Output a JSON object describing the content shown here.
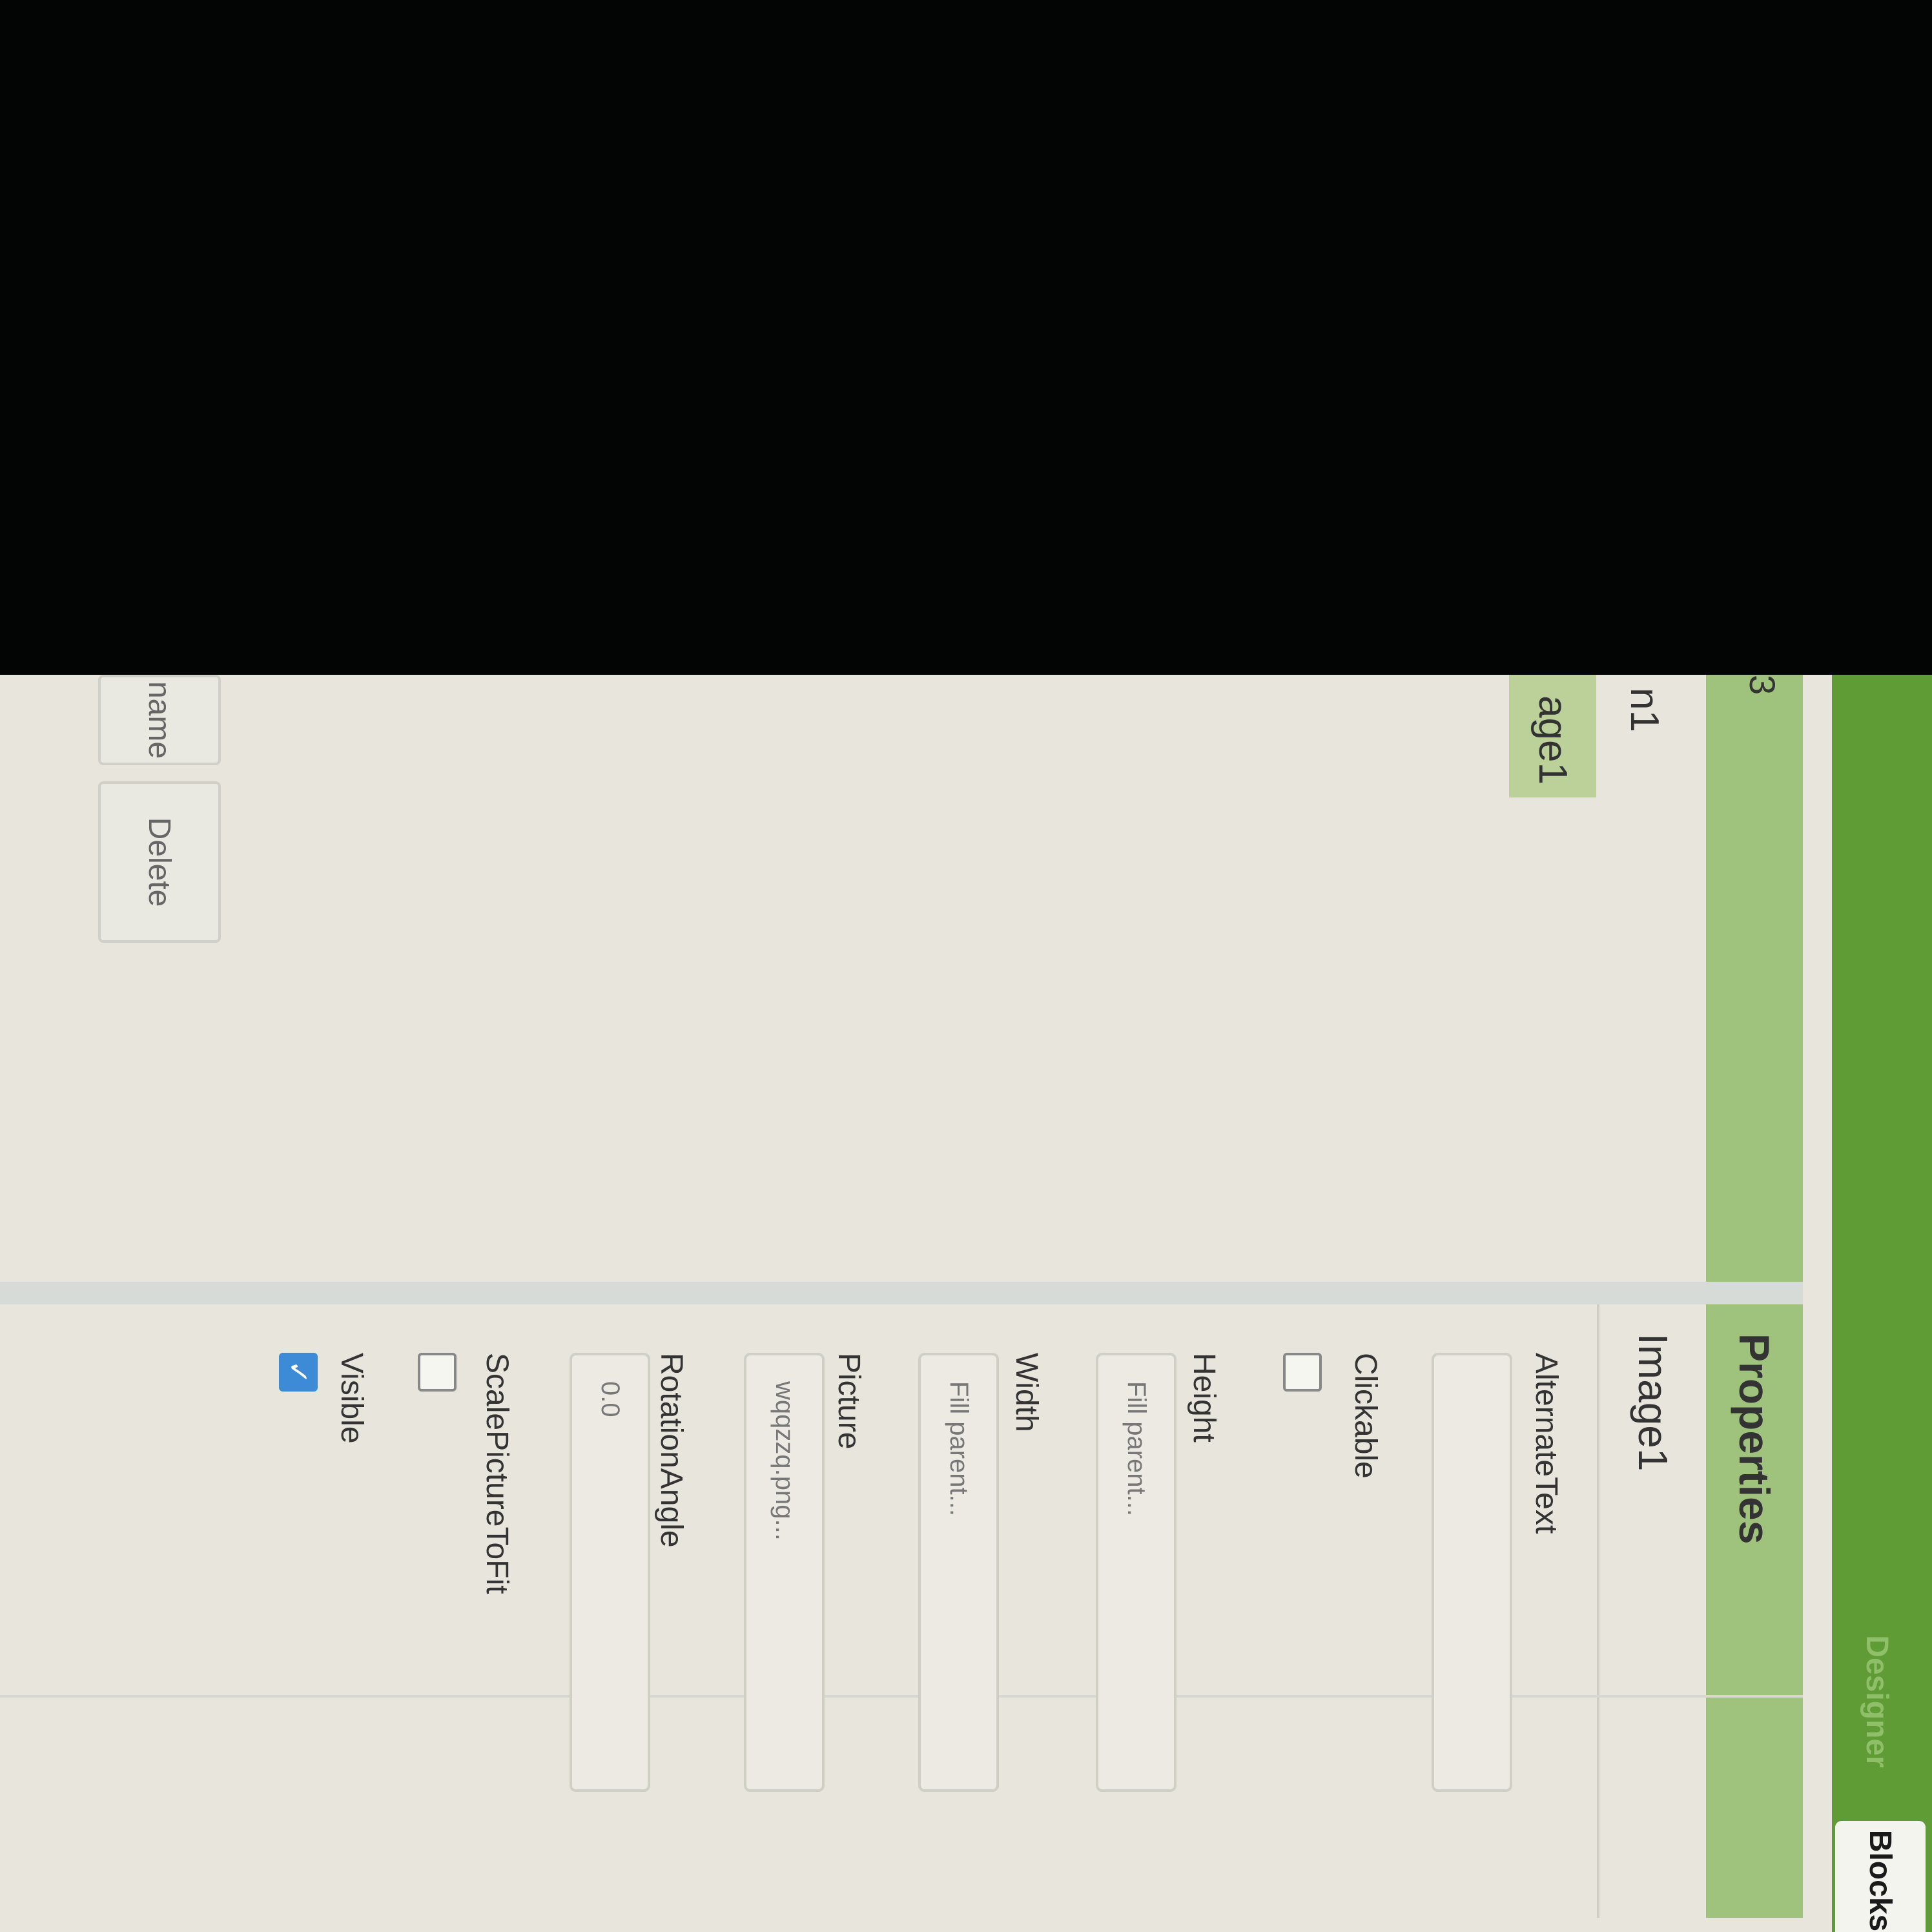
{
  "toolbar": {
    "designer_label": "Designer",
    "blocks_label": "Blocks"
  },
  "components_panel": {
    "header_fragment": "3",
    "items": [
      "n1",
      "age1"
    ],
    "rename_label": "name",
    "delete_label": "Delete"
  },
  "properties_panel": {
    "title": "Properties",
    "component": "Image1",
    "alternate_text": {
      "label": "AlternateText",
      "value": ""
    },
    "clickable": {
      "label": "Clickable",
      "checked": false
    },
    "height": {
      "label": "Height",
      "value": "Fill parent..."
    },
    "width": {
      "label": "Width",
      "value": "Fill parent..."
    },
    "picture": {
      "label": "Picture",
      "value": "wqqzzq.png..."
    },
    "rotation_angle": {
      "label": "RotationAngle",
      "value": "0.0"
    },
    "scale_picture_to_fit": {
      "label": "ScalePictureToFit",
      "checked": false
    },
    "visible": {
      "label": "Visible",
      "checked": true
    }
  }
}
